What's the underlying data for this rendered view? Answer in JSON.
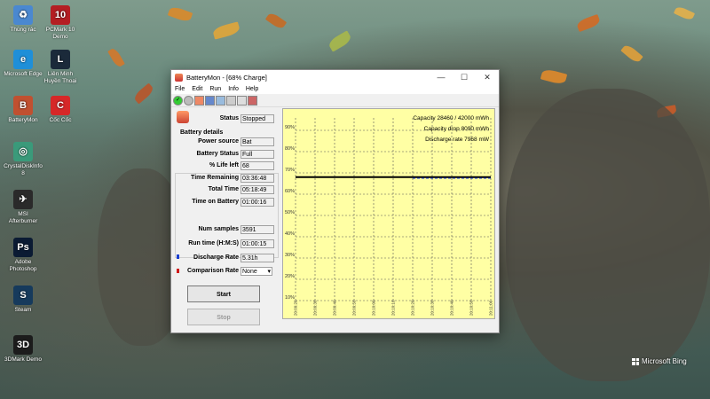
{
  "desktop": {
    "icons": [
      {
        "label": "Thùng rác",
        "color": "#4a88d0",
        "glyph": "♻"
      },
      {
        "label": "PCMark 10 Demo",
        "color": "#b41e23",
        "glyph": "10"
      },
      {
        "label": "Microsoft Edge",
        "color": "#1f8fd8",
        "glyph": "e"
      },
      {
        "label": "Liên Minh Huyền Thoại",
        "color": "#1b2a3a",
        "glyph": "L"
      },
      {
        "label": "BatteryMon",
        "color": "#c05030",
        "glyph": "B"
      },
      {
        "label": "Cốc Cốc",
        "color": "#d62828",
        "glyph": "C"
      },
      {
        "label": "CrystalDiskInfo 8",
        "color": "#3a9a7a",
        "glyph": "◎"
      },
      {
        "label": "MSI Afterburner",
        "color": "#2a2a2a",
        "glyph": "✈"
      },
      {
        "label": "Adobe Photoshop",
        "color": "#0b1b33",
        "glyph": "Ps"
      },
      {
        "label": "Steam",
        "color": "#163a5c",
        "glyph": "S"
      },
      {
        "label": "3DMark Demo",
        "color": "#1c1c1c",
        "glyph": "3D"
      }
    ],
    "watermark": "Microsoft Bing"
  },
  "window": {
    "title": "BatteryMon - [68% Charge]",
    "minimize": "—",
    "maximize": "☐",
    "close": "✕",
    "menu": [
      "File",
      "Edit",
      "Run",
      "Info",
      "Help"
    ],
    "toolbar_icons": [
      "check-icon",
      "stop-icon",
      "battery-icon",
      "save-icon",
      "chart-icon",
      "graph-icon",
      "settings-icon",
      "print-icon"
    ]
  },
  "status": {
    "label": "Status",
    "value": "Stopped"
  },
  "battery_details": {
    "title": "Battery details",
    "fields": [
      {
        "label": "Power source",
        "value": "Bat"
      },
      {
        "label": "Battery Status",
        "value": "Full"
      },
      {
        "label": "% Life left",
        "value": "68"
      },
      {
        "label": "Time Remaining",
        "value": "03:36:48"
      },
      {
        "label": "Total Time",
        "value": "05:18:49"
      },
      {
        "label": "Time on Battery",
        "value": "01:00:16"
      }
    ]
  },
  "stats": [
    {
      "label": "Num samples",
      "value": "3591"
    },
    {
      "label": "Run time (H:M:S)",
      "value": "01:00:15"
    },
    {
      "label": "Discharge Rate",
      "value": "5.31h"
    }
  ],
  "comparison": {
    "label": "Comparison Rate",
    "value": "None"
  },
  "buttons": {
    "start": "Start",
    "stop": "Stop"
  },
  "colors": {
    "discharge_legend": "#1a3fd0",
    "comparison_legend": "#d01a1a",
    "chart_bg": "#ffffa4"
  },
  "chart_info": [
    "Capacity 28460 / 42000 mWh",
    "Capacity drop 8090 mWh",
    "Discharge rate 7968 mW"
  ],
  "chart_data": {
    "type": "line",
    "title": "",
    "ylabel": "",
    "xlabel": "",
    "ylim": [
      10,
      90
    ],
    "yticks": [
      "90%",
      "80%",
      "70%",
      "60%",
      "50%",
      "40%",
      "30%",
      "20%",
      "10%"
    ],
    "xticks": [
      "20:09:26",
      "20:09:36",
      "20:09:46",
      "20:09:56",
      "20:10:06",
      "20:10:16",
      "20:10:26",
      "20:10:36",
      "20:10:46",
      "20:10:56",
      "20:11:06"
    ],
    "grid": true,
    "series": [
      {
        "name": "Charge",
        "color": "#000000",
        "x": [
          "20:09:26",
          "20:11:06"
        ],
        "values": [
          68,
          68
        ]
      },
      {
        "name": "Discharge",
        "color": "#1a3fd0",
        "x": [
          "20:10:26",
          "20:11:06"
        ],
        "values": [
          67.5,
          67.5
        ]
      }
    ]
  }
}
